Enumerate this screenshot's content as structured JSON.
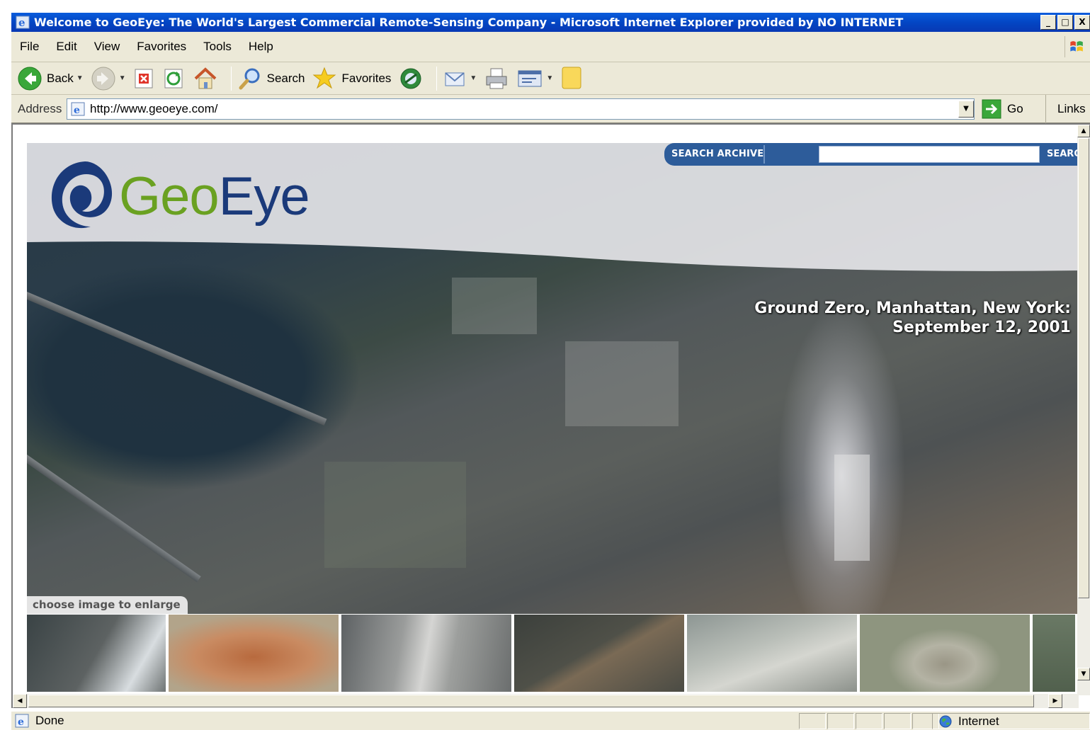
{
  "window": {
    "title": "Welcome to GeoEye: The World's Largest Commercial Remote-Sensing Company - Microsoft Internet Explorer provided by NO INTERNET",
    "minimize": "_",
    "maximize": "□",
    "close": "X"
  },
  "menu": {
    "items": [
      "File",
      "Edit",
      "View",
      "Favorites",
      "Tools",
      "Help"
    ]
  },
  "toolbar": {
    "back_label": "Back",
    "search_label": "Search",
    "favorites_label": "Favorites"
  },
  "address": {
    "label": "Address",
    "url": "http://www.geoeye.com/",
    "go_label": "Go",
    "links_label": "Links"
  },
  "page": {
    "logo_geo": "Geo",
    "logo_eye": "Eye",
    "search_archive_label": "SEARCH ARCHIVE",
    "search_button_label": "SEARC",
    "search_input_value": "",
    "caption_line1": "Ground Zero, Manhattan, New York:",
    "caption_line2": "September 12, 2001",
    "enlarge_hint": "choose image to enlarge",
    "thumbnail_count": 7
  },
  "status": {
    "text": "Done",
    "zone": "Internet"
  },
  "colors": {
    "titlebar": "#0346c4",
    "chrome": "#ece9d8",
    "logo_green": "#6aa121",
    "logo_blue": "#1b3a7a",
    "search_bar": "#2d5c9a"
  }
}
